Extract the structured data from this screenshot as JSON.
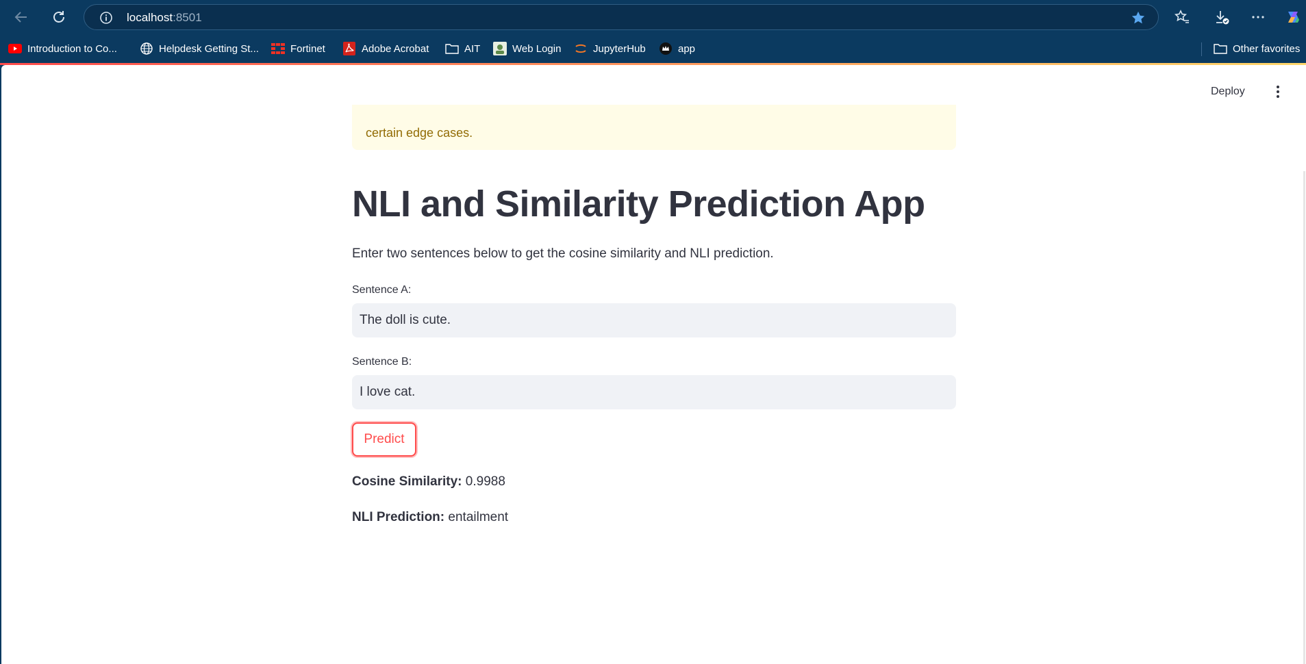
{
  "browser": {
    "url_host": "localhost",
    "url_port": ":8501",
    "bookmarks": [
      {
        "label": "Introduction to Co...",
        "icon": "youtube-icon"
      },
      {
        "label": "Helpdesk Getting St...",
        "icon": "globe-icon"
      },
      {
        "label": "Fortinet",
        "icon": "fortinet-icon"
      },
      {
        "label": "Adobe Acrobat",
        "icon": "acrobat-icon"
      },
      {
        "label": "AIT",
        "icon": "folder-icon"
      },
      {
        "label": "Web Login",
        "icon": "web-login-icon"
      },
      {
        "label": "JupyterHub",
        "icon": "jupyter-icon"
      },
      {
        "label": "app",
        "icon": "app-icon"
      }
    ],
    "other_favorites": "Other favorites"
  },
  "app": {
    "deploy_label": "Deploy",
    "warning_text": "certain edge cases.",
    "title": "NLI and Similarity Prediction App",
    "subtitle": "Enter two sentences below to get the cosine similarity and NLI prediction.",
    "sentence_a": {
      "label": "Sentence A:",
      "value": "The doll is cute."
    },
    "sentence_b": {
      "label": "Sentence B:",
      "value": "I love cat."
    },
    "predict_label": "Predict",
    "cosine": {
      "label": "Cosine Similarity:",
      "value": "0.9988"
    },
    "nli": {
      "label": "NLI Prediction:",
      "value": "entailment"
    }
  },
  "colors": {
    "chrome": "#0b3a60",
    "accent": "#ff4b4b",
    "warning_bg": "#fffce7",
    "warning_text": "#926c05",
    "input_bg": "#f0f2f6",
    "text": "#31333f"
  }
}
